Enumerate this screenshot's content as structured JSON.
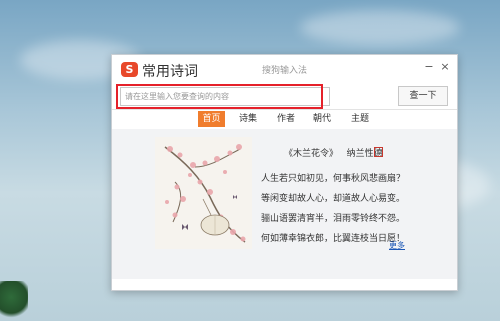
{
  "window": {
    "app_name": "常用诗词",
    "logo_letter": "S",
    "ime_hint": "搜狗输入法",
    "minimize_label": "−",
    "close_label": "×"
  },
  "search": {
    "placeholder": "请在这里输入您要查询的内容",
    "value": "",
    "button_label": "查一下"
  },
  "nav": {
    "tabs": [
      {
        "label": "首页",
        "active": true
      },
      {
        "label": "诗集",
        "active": false
      },
      {
        "label": "作者",
        "active": false
      },
      {
        "label": "朝代",
        "active": false
      },
      {
        "label": "主题",
        "active": false
      }
    ]
  },
  "poem": {
    "title": "《木兰花令》",
    "author": "纳兰性德",
    "lines": [
      "人生若只如初见，何事秋风悲画扇？",
      "等闲变却故人心，却道故人心易变。",
      "骊山语罢清宵半，泪雨零铃终不怨。",
      "何如薄幸锦衣郎，比翼连枝当日愿！"
    ],
    "more_label": "更多"
  },
  "colors": {
    "accent": "#f07d2d",
    "highlight": "#e5212a",
    "link": "#1a56b6",
    "logo": "#e8482a"
  }
}
